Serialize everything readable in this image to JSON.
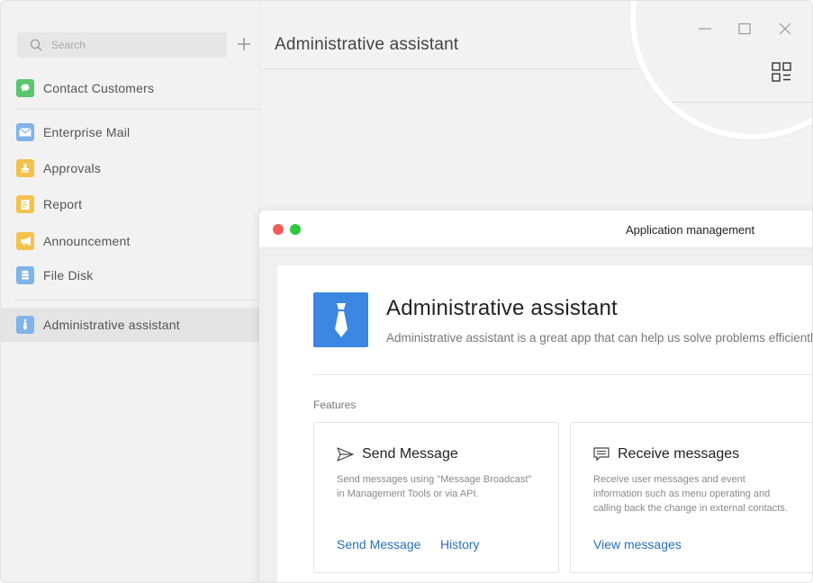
{
  "sidebar": {
    "search": {
      "placeholder": "Search"
    },
    "add_icon": "plus-icon",
    "items": [
      {
        "label": "Contact Customers",
        "icon": "chat-bubble-icon",
        "color": "#5bc46f"
      },
      {
        "label": "Enterprise Mail",
        "icon": "envelope-icon",
        "color": "#7fb3ea"
      },
      {
        "label": "Approvals",
        "icon": "stamp-icon",
        "color": "#f3c24d"
      },
      {
        "label": "Report",
        "icon": "report-icon",
        "color": "#f3c24d"
      },
      {
        "label": "Announcement",
        "icon": "megaphone-icon",
        "color": "#f3c24d"
      },
      {
        "label": "File Disk",
        "icon": "database-icon",
        "color": "#7fb3ea"
      },
      {
        "label": "Administrative assistant",
        "icon": "tie-icon",
        "color": "#7fb3ea",
        "active": true
      }
    ]
  },
  "header": {
    "title": "Administrative assistant"
  },
  "window_controls": {
    "minimize": "minimize-icon",
    "maximize": "maximize-icon",
    "close": "close-icon",
    "apps": "app-grid-icon"
  },
  "app_window": {
    "title": "Application management",
    "dots": {
      "close_color": "#f25c54",
      "zoom_color": "#2dc842"
    },
    "app": {
      "name": "Administrative assistant",
      "description": "Administrative assistant is a great app that can help us solve problems efficiently",
      "logo_color": "#3a86e0"
    },
    "features_label": "Features",
    "features": [
      {
        "icon": "send-icon",
        "title": "Send Message",
        "description_lines": [
          "Send messages using \"Message Broadcast\"",
          "in Management Tools or via API."
        ],
        "links": [
          "Send Message",
          "History"
        ]
      },
      {
        "icon": "message-list-icon",
        "title": "Receive messages",
        "description_lines": [
          "Receive user messages and event",
          "information such as menu operating and",
          "calling back the change in external contacts."
        ],
        "links": [
          "View messages"
        ]
      }
    ]
  },
  "colors": {
    "sidebar_bg": "#f2f2f2",
    "active_item_bg": "#e4e4e4",
    "link": "#2a6fb8",
    "accent": "#3a86e0"
  }
}
